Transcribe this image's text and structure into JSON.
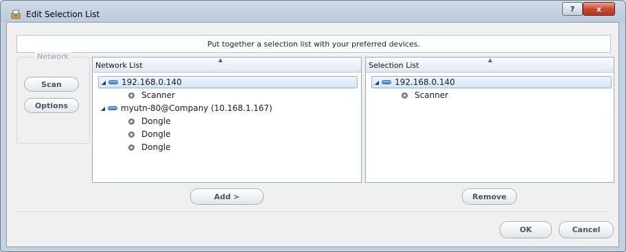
{
  "window": {
    "title": "Edit Selection List",
    "help_label": "?",
    "close_label": "x"
  },
  "banner": {
    "text": "Put together a selection list with your preferred devices."
  },
  "network_group": {
    "label": "Network",
    "scan_label": "Scan",
    "options_label": "Options"
  },
  "network_list": {
    "header": "Network List",
    "sort_glyph": "▲",
    "items": [
      {
        "label": "192.168.0.140",
        "expander": "◢",
        "children": [
          "Scanner"
        ]
      },
      {
        "label": "myutn-80@Company (10.168.1.167)",
        "expander": "◢",
        "children": [
          "Dongle",
          "Dongle",
          "Dongle"
        ]
      }
    ]
  },
  "selection_list": {
    "header": "Selection List",
    "sort_glyph": "▲",
    "items": [
      {
        "label": "192.168.0.140",
        "expander": "◢",
        "children": [
          "Scanner"
        ]
      }
    ]
  },
  "actions": {
    "add_label": "Add >",
    "remove_label": "Remove",
    "ok_label": "OK",
    "cancel_label": "Cancel"
  }
}
